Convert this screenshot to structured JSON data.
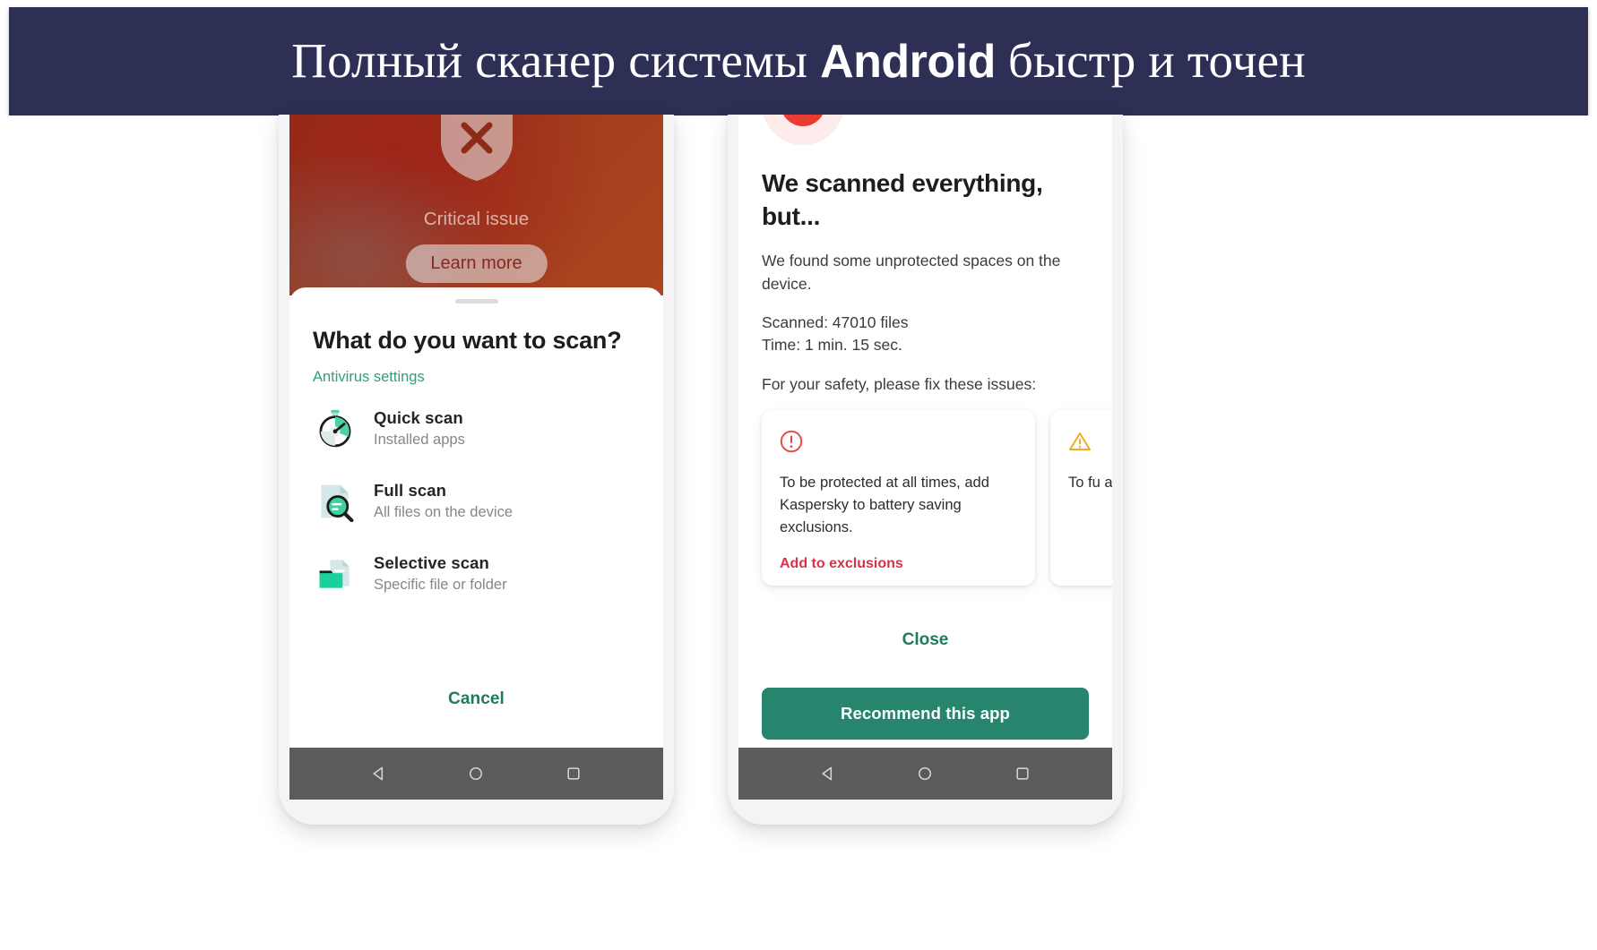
{
  "banner": {
    "text_before": "Полный сканер системы ",
    "brand": "Android",
    "text_after": " быстр и точен",
    "bg_color": "#2e2f55",
    "text_color": "#ffffff"
  },
  "left_phone": {
    "hero": {
      "icon": "shield-x-icon",
      "status_label": "Critical issue",
      "learn_more_label": "Learn more",
      "bg_color": "#a23b1d"
    },
    "sheet": {
      "title": "What do you want to scan?",
      "settings_link": "Antivirus settings",
      "settings_link_color": "#2f9e7c",
      "scan_options": [
        {
          "icon": "stopwatch-icon",
          "title": "Quick scan",
          "subtitle": "Installed apps"
        },
        {
          "icon": "document-magnifier-icon",
          "title": "Full scan",
          "subtitle": "All files on the device"
        },
        {
          "icon": "folder-document-icon",
          "title": "Selective scan",
          "subtitle": "Specific file or folder"
        }
      ],
      "cancel_label": "Cancel",
      "cancel_color": "#1f7a5e"
    },
    "navbar": {
      "back": "back-triangle-icon",
      "home": "home-circle-icon",
      "recents": "recents-square-icon",
      "bg_color": "#5c5a5a"
    }
  },
  "right_phone": {
    "badge": {
      "icon": "exclamation-badge-icon",
      "color": "#ec3a32",
      "halo_color": "#fdeceb"
    },
    "title": "We scanned everything, but...",
    "description": "We found some unprotected spaces on the device.",
    "stats": {
      "scanned": "Scanned: 47010 files",
      "time": "Time: 1 min. 15 sec."
    },
    "cta_text": "For your safety, please fix these issues:",
    "issue_cards": [
      {
        "icon": "circle-exclamation-icon",
        "icon_color": "#e8453c",
        "text": "To be protected at all times, add Kaspersky to battery saving exclusions.",
        "action_label": "Add to exclusions",
        "action_color": "#d6324b"
      },
      {
        "icon": "warning-triangle-icon",
        "icon_color": "#f0ad24",
        "text": "To fu app r folde",
        "action_label": "",
        "action_color": "#d6324b"
      }
    ],
    "close_label": "Close",
    "close_color": "#1f7a5e",
    "recommend_label": "Recommend this app",
    "recommend_color": "#26856c",
    "navbar": {
      "back": "back-triangle-icon",
      "home": "home-circle-icon",
      "recents": "recents-square-icon",
      "bg_color": "#5c5a5a"
    }
  }
}
